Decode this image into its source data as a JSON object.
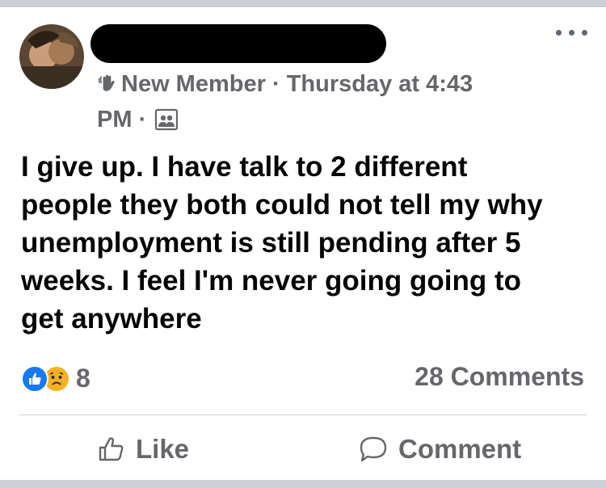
{
  "author": {
    "badge": "New Member",
    "separator": "·",
    "time_line1": "Thursday at 4:43",
    "time_line2": "PM",
    "separator2": "·"
  },
  "post": {
    "text": "I give up.  I have talk to 2 different\npeople they both could not tell my why\nunemployment is still pending after 5\nweeks.  I feel I'm never going going to\nget anywhere"
  },
  "reactions": {
    "count": "8",
    "types": [
      "like",
      "sad"
    ]
  },
  "comments": {
    "count_label": "28 Comments"
  },
  "actions": {
    "like_label": "Like",
    "comment_label": "Comment"
  },
  "colors": {
    "meta_gray": "#65676b",
    "like_blue": "#1877f2",
    "sad_yellow": "#f7b125",
    "text": "#050505"
  }
}
